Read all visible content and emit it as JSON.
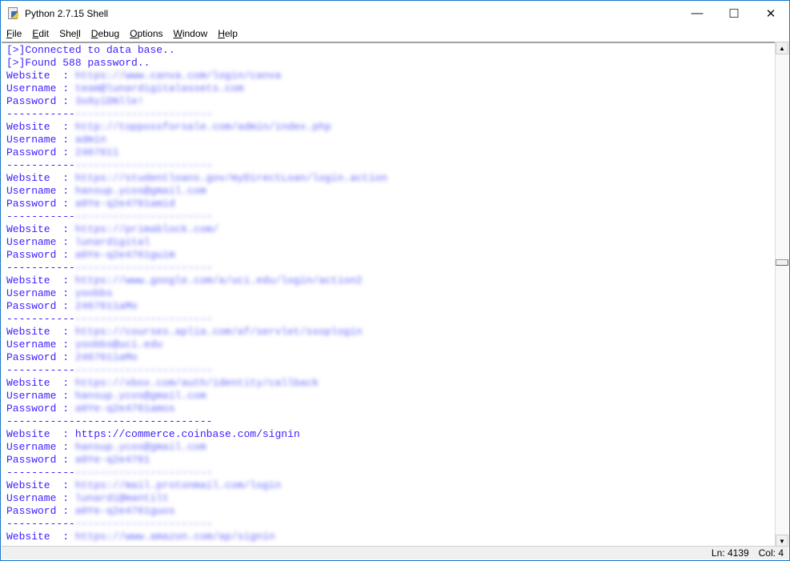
{
  "window": {
    "title": "Python 2.7.15 Shell",
    "minimize": "—",
    "maximize": "☐",
    "close": "✕"
  },
  "menu": [
    {
      "label": "File",
      "u": "F",
      "rest": "ile"
    },
    {
      "label": "Edit",
      "u": "E",
      "rest": "dit"
    },
    {
      "label": "Shell",
      "pre": "She",
      "u": "l",
      "rest": "l"
    },
    {
      "label": "Debug",
      "u": "D",
      "rest": "ebug"
    },
    {
      "label": "Options",
      "u": "O",
      "rest": "ptions"
    },
    {
      "label": "Window",
      "u": "W",
      "rest": "indow"
    },
    {
      "label": "Help",
      "u": "H",
      "rest": "elp"
    }
  ],
  "shell": {
    "header": [
      "[>]Connected to data base..",
      "[>]Found 588 password.."
    ],
    "labels": {
      "website": "Website  : ",
      "username": "Username : ",
      "password": "Password : "
    },
    "separator_visible": "-----------",
    "separator_rest": "----------------------",
    "separator_full": "---------------------------------",
    "entries": [
      {
        "website": "https://www.canva.com/login/canva",
        "username": "team@lunardigitalassets.com",
        "password": "3x0yiDNlle!",
        "blurred": true
      },
      {
        "website": "http://toppossforsale.com/admin/index.php",
        "username": "admin",
        "password": "2467611",
        "blurred": true
      },
      {
        "website": "https://studentloans.gov/myDirectLoan/login.action",
        "username": "hansup.ycos@gmail.com",
        "password": "a0Ye-q2e4761amid",
        "blurred": true
      },
      {
        "website": "https://primablock.com/",
        "username": "lunardigital",
        "password": "a0Ye-q2e4761guim",
        "blurred": true
      },
      {
        "website": "https://www.google.com/a/uci.edu/login/action2",
        "username": "yoobbs",
        "password": "2467611aMo",
        "blurred": true
      },
      {
        "website": "https://courses.aplia.com/af/servlet/ssoplogin",
        "username": "yoobbs@uci.edu",
        "password": "2467611aMo",
        "blurred": true
      },
      {
        "website": "https://xbox.com/auth/identity/callback",
        "username": "hansup.ycos@gmail.com",
        "password": "a0Ye-q2e4761amos",
        "blurred": true,
        "full_separator_after": true
      },
      {
        "website": "https://commerce.coinbase.com/signin",
        "username": "hansup.ycos@gmail.com",
        "password": "a0Ye-q2e4761",
        "blurred": false
      },
      {
        "website": "https://mail.protonmail.com/login",
        "username": "lunardi@mantilt",
        "password": "a0Ye-q2e4761guos",
        "blurred": true
      },
      {
        "website": "https://www.amazon.com/ap/signin",
        "blurred": true,
        "partial": true
      }
    ]
  },
  "status": {
    "line": "Ln: 4139",
    "col": "Col: 4"
  },
  "colors": {
    "text": "#3b1eff",
    "border": "#1979ca"
  }
}
